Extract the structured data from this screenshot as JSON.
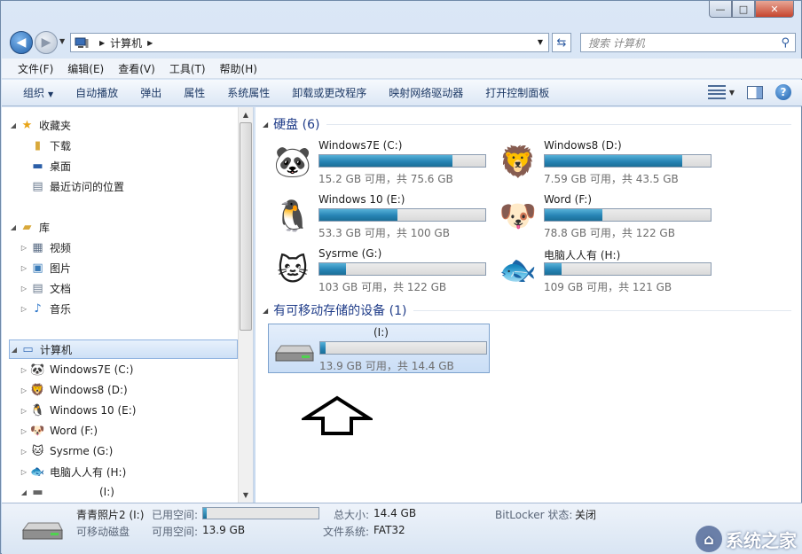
{
  "window": {
    "caption_minimize": "—",
    "caption_maximize": "□",
    "caption_close": "✕"
  },
  "address": {
    "path": "计算机",
    "search_placeholder": "搜索 计算机"
  },
  "menu": [
    "文件(F)",
    "编辑(E)",
    "查看(V)",
    "工具(T)",
    "帮助(H)"
  ],
  "commands": [
    "组织",
    "自动播放",
    "弹出",
    "属性",
    "系统属性",
    "卸载或更改程序",
    "映射网络驱动器",
    "打开控制面板"
  ],
  "nav": {
    "favorites": {
      "label": "收藏夹",
      "items": [
        "下载",
        "桌面",
        "最近访问的位置"
      ]
    },
    "libraries": {
      "label": "库",
      "items": [
        "视频",
        "图片",
        "文档",
        "音乐"
      ]
    },
    "computer": {
      "label": "计算机",
      "items": [
        "Windows7E (C:)",
        "Windows8 (D:)",
        "Windows 10 (E:)",
        "Word (F:)",
        "Sysrme (G:)",
        "电脑人人有 (H:)",
        "(I:)"
      ]
    }
  },
  "content": {
    "hard_disks": {
      "header": "硬盘 (6)",
      "drives": [
        {
          "name": "Windows7E (C:)",
          "size_text": "15.2 GB 可用，共 75.6 GB",
          "used_fraction": 0.8,
          "icon": "panda-icon"
        },
        {
          "name": "Windows8 (D:)",
          "size_text": "7.59 GB 可用，共 43.5 GB",
          "used_fraction": 0.83,
          "icon": "lion-icon"
        },
        {
          "name": "Windows 10 (E:)",
          "size_text": "53.3 GB 可用，共 100 GB",
          "used_fraction": 0.47,
          "icon": "penguin-icon"
        },
        {
          "name": "Word (F:)",
          "size_text": "78.8 GB 可用，共 122 GB",
          "used_fraction": 0.35,
          "icon": "dog-icon"
        },
        {
          "name": "Sysrme (G:)",
          "size_text": "103 GB 可用，共 122 GB",
          "used_fraction": 0.16,
          "icon": "cat-icon"
        },
        {
          "name": "电脑人人有 (H:)",
          "size_text": "109 GB 可用，共 121 GB",
          "used_fraction": 0.1,
          "icon": "fish-icon"
        }
      ]
    },
    "removable": {
      "header": "有可移动存储的设备 (1)",
      "drives": [
        {
          "name": "(I:)",
          "size_text": "13.9 GB 可用，共 14.4 GB",
          "used_fraction": 0.03,
          "icon": "usb-drive-icon"
        }
      ]
    }
  },
  "details": {
    "name": "青青照片2 (I:)",
    "type": "可移动磁盘",
    "used_label": "已用空间:",
    "used_fraction": 0.03,
    "free_label": "可用空间:",
    "free_value": "13.9 GB",
    "total_label": "总大小:",
    "total_value": "14.4 GB",
    "fs_label": "文件系统:",
    "fs_value": "FAT32",
    "bitlocker_label": "BitLocker 状态:",
    "bitlocker_value": "关闭"
  },
  "watermark": "系统之家",
  "colors": {
    "accent": "#1e3b88",
    "bar_fill": "#2784b5",
    "selection": "#cde0f6"
  }
}
